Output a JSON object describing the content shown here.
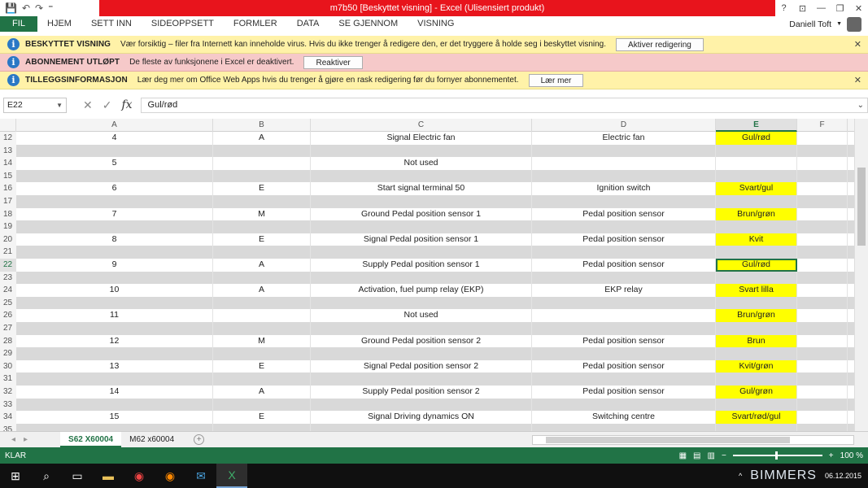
{
  "window": {
    "title": "m7b50  [Beskyttet visning] - Excel (Ulisensiert produkt)",
    "controls": [
      "?",
      "⊡",
      "—",
      "❐",
      "✕"
    ]
  },
  "qat": {
    "save_icon": "save-icon",
    "undo_icon": "undo-icon",
    "redo_icon": "redo-icon"
  },
  "ribbon": {
    "file": "FIL",
    "tabs": [
      "HJEM",
      "SETT INN",
      "SIDEOPPSETT",
      "FORMLER",
      "DATA",
      "SE GJENNOM",
      "VISNING"
    ],
    "user": "Daniell Toft"
  },
  "messagebars": [
    {
      "head": "BESKYTTET VISNING",
      "msg": "Vær forsiktig – filer fra Internett kan inneholde virus. Hvis du ikke trenger å redigere den, er det tryggere å holde seg i beskyttet visning.",
      "button": "Aktiver redigering",
      "color": "#fff2a8"
    },
    {
      "head": "ABONNEMENT UTLØPT",
      "msg": "De fleste av funksjonene i Excel er deaktivert.",
      "button": "Reaktiver",
      "color": "#f6c9c9"
    },
    {
      "head": "TILLEGGSINFORMASJON",
      "msg": "Lær deg mer om Office Web Apps hvis du trenger å gjøre en rask redigering før du fornyer abonnementet.",
      "button": "Lær mer",
      "color": "#fff2a8"
    }
  ],
  "formula": {
    "namebox": "E22",
    "value": "Gul/rød"
  },
  "columns": [
    "A",
    "B",
    "C",
    "D",
    "E",
    "F"
  ],
  "selected_column": "E",
  "selected_row": "22",
  "rows": [
    {
      "n": "12",
      "grey": false,
      "a": "4",
      "b": "A",
      "c": "Signal Electric fan",
      "d": "Electric fan",
      "e": "Gul/rød",
      "yellow": true
    },
    {
      "n": "13",
      "grey": true,
      "a": "",
      "b": "",
      "c": "",
      "d": "",
      "e": "",
      "yellow": false
    },
    {
      "n": "14",
      "grey": false,
      "a": "5",
      "b": "",
      "c": "Not used",
      "d": "",
      "e": "",
      "yellow": false
    },
    {
      "n": "15",
      "grey": true,
      "a": "",
      "b": "",
      "c": "",
      "d": "",
      "e": "",
      "yellow": false
    },
    {
      "n": "16",
      "grey": false,
      "a": "6",
      "b": "E",
      "c": "Start signal terminal 50",
      "d": "Ignition switch",
      "e": "Svart/gul",
      "yellow": true
    },
    {
      "n": "17",
      "grey": true,
      "a": "",
      "b": "",
      "c": "",
      "d": "",
      "e": "",
      "yellow": false
    },
    {
      "n": "18",
      "grey": false,
      "a": "7",
      "b": "M",
      "c": "Ground Pedal position sensor 1",
      "d": "Pedal position sensor",
      "e": "Brun/grøn",
      "yellow": true
    },
    {
      "n": "19",
      "grey": true,
      "a": "",
      "b": "",
      "c": "",
      "d": "",
      "e": "",
      "yellow": false
    },
    {
      "n": "20",
      "grey": false,
      "a": "8",
      "b": "E",
      "c": "Signal Pedal position sensor 1",
      "d": "Pedal position sensor",
      "e": "Kvit",
      "yellow": true
    },
    {
      "n": "21",
      "grey": true,
      "a": "",
      "b": "",
      "c": "",
      "d": "",
      "e": "",
      "yellow": false
    },
    {
      "n": "22",
      "grey": false,
      "a": "9",
      "b": "A",
      "c": "Supply Pedal position sensor 1",
      "d": "Pedal position sensor",
      "e": "Gul/rød",
      "yellow": true
    },
    {
      "n": "23",
      "grey": true,
      "a": "",
      "b": "",
      "c": "",
      "d": "",
      "e": "",
      "yellow": false
    },
    {
      "n": "24",
      "grey": false,
      "a": "10",
      "b": "A",
      "c": "Activation, fuel pump relay (EKP)",
      "d": "EKP relay",
      "e": "Svart lilla",
      "yellow": true
    },
    {
      "n": "25",
      "grey": true,
      "a": "",
      "b": "",
      "c": "",
      "d": "",
      "e": "",
      "yellow": false
    },
    {
      "n": "26",
      "grey": false,
      "a": "11",
      "b": "",
      "c": "Not used",
      "d": "",
      "e": "Brun/grøn",
      "yellow": true
    },
    {
      "n": "27",
      "grey": true,
      "a": "",
      "b": "",
      "c": "",
      "d": "",
      "e": "",
      "yellow": false
    },
    {
      "n": "28",
      "grey": false,
      "a": "12",
      "b": "M",
      "c": "Ground Pedal position sensor 2",
      "d": "Pedal position sensor",
      "e": "Brun",
      "yellow": true
    },
    {
      "n": "29",
      "grey": true,
      "a": "",
      "b": "",
      "c": "",
      "d": "",
      "e": "",
      "yellow": false
    },
    {
      "n": "30",
      "grey": false,
      "a": "13",
      "b": "E",
      "c": "Signal Pedal position sensor 2",
      "d": "Pedal position sensor",
      "e": "Kvit/grøn",
      "yellow": true
    },
    {
      "n": "31",
      "grey": true,
      "a": "",
      "b": "",
      "c": "",
      "d": "",
      "e": "",
      "yellow": false
    },
    {
      "n": "32",
      "grey": false,
      "a": "14",
      "b": "A",
      "c": "Supply Pedal position sensor 2",
      "d": "Pedal position sensor",
      "e": "Gul/grøn",
      "yellow": true
    },
    {
      "n": "33",
      "grey": true,
      "a": "",
      "b": "",
      "c": "",
      "d": "",
      "e": "",
      "yellow": false
    },
    {
      "n": "34",
      "grey": false,
      "a": "15",
      "b": "E",
      "c": "Signal Driving dynamics ON",
      "d": "Switching centre",
      "e": "Svart/rød/gul",
      "yellow": true
    },
    {
      "n": "35",
      "grey": true,
      "a": "",
      "b": "",
      "c": "",
      "d": "",
      "e": "",
      "yellow": false
    }
  ],
  "sheets": [
    "S62 X60004",
    "M62 x60004"
  ],
  "active_sheet": "S62 X60004",
  "status": {
    "ready": "KLAR",
    "zoom": "100 %"
  },
  "taskbar": {
    "date": "06.12.2015",
    "watermark": "BIMMERS"
  },
  "colors": {
    "excel_green": "#217346",
    "title_red": "#e8141c",
    "highlight_yellow": "#ffff00"
  }
}
